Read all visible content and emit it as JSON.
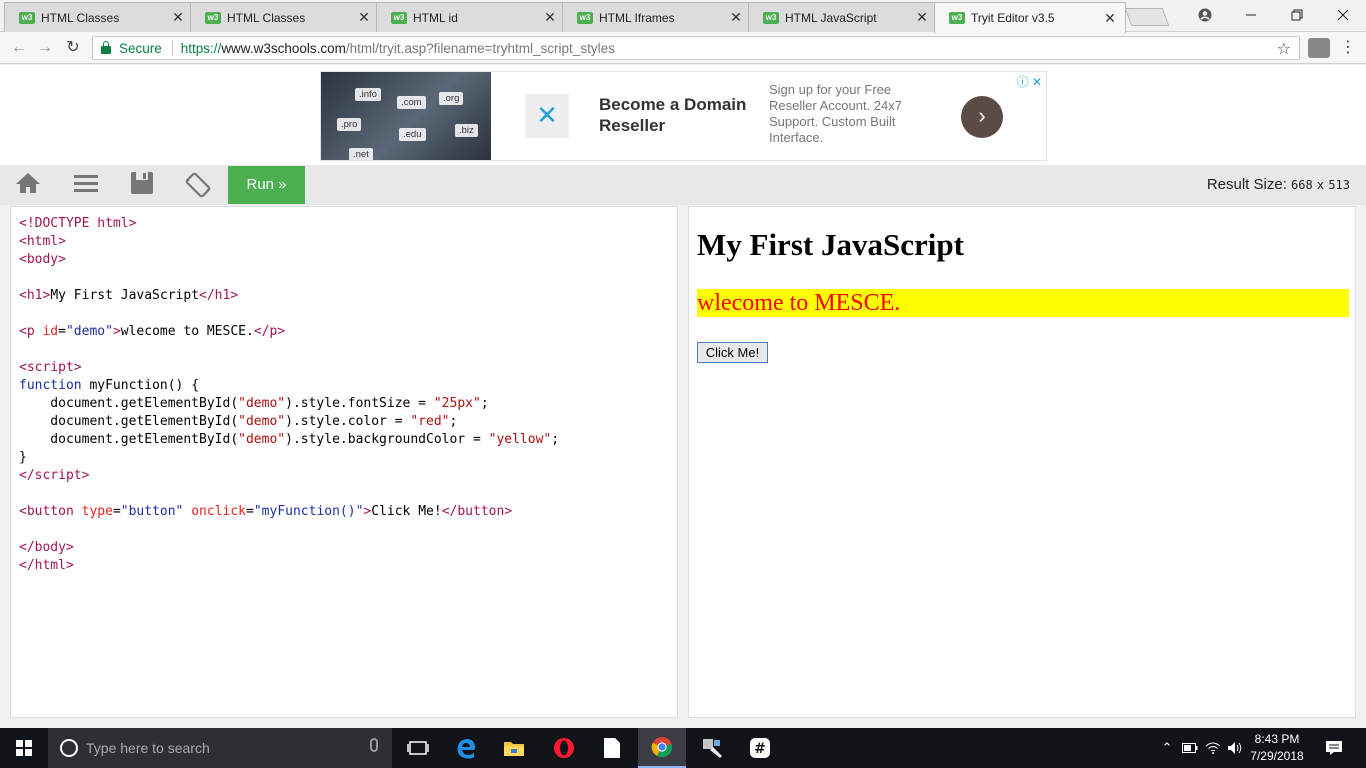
{
  "browser": {
    "tabs": [
      {
        "label": "HTML Classes",
        "favicon": "w3"
      },
      {
        "label": "HTML Classes",
        "favicon": "w3"
      },
      {
        "label": "HTML id",
        "favicon": "w3"
      },
      {
        "label": "HTML Iframes",
        "favicon": "w3"
      },
      {
        "label": "HTML JavaScript",
        "favicon": "w3"
      },
      {
        "label": "Tryit Editor v3.5",
        "favicon": "w3"
      }
    ],
    "tab_close": "✕",
    "secure_label": "Secure",
    "url_scheme": "https://",
    "url_host": "www.w3schools.com",
    "url_path": "/html/tryit.asp?filename=tryhtml_script_styles"
  },
  "ad": {
    "chips": [
      ".info",
      ".com",
      ".org",
      ".pro",
      ".edu",
      ".biz",
      ".net"
    ],
    "headline": "Become a Domain Reseller",
    "body": "Sign up for your Free Reseller Account. 24x7 Support. Custom Built Interface.",
    "go": "›",
    "info": "ⓘ ✕"
  },
  "toolbar": {
    "run_label": "Run »",
    "result_size_label": "Result Size:",
    "result_width": "668",
    "result_x": "x",
    "result_height": "513"
  },
  "result": {
    "heading": "My First JavaScript",
    "paragraph": "wlecome to MESCE.",
    "button": "Click Me!"
  },
  "taskbar": {
    "search_placeholder": "Type here to search",
    "time": "8:43 PM",
    "date": "7/29/2018"
  },
  "colors": {
    "run_green": "#4caf50",
    "highlight_yellow": "#ffff00",
    "text_red": "#ff0000"
  }
}
